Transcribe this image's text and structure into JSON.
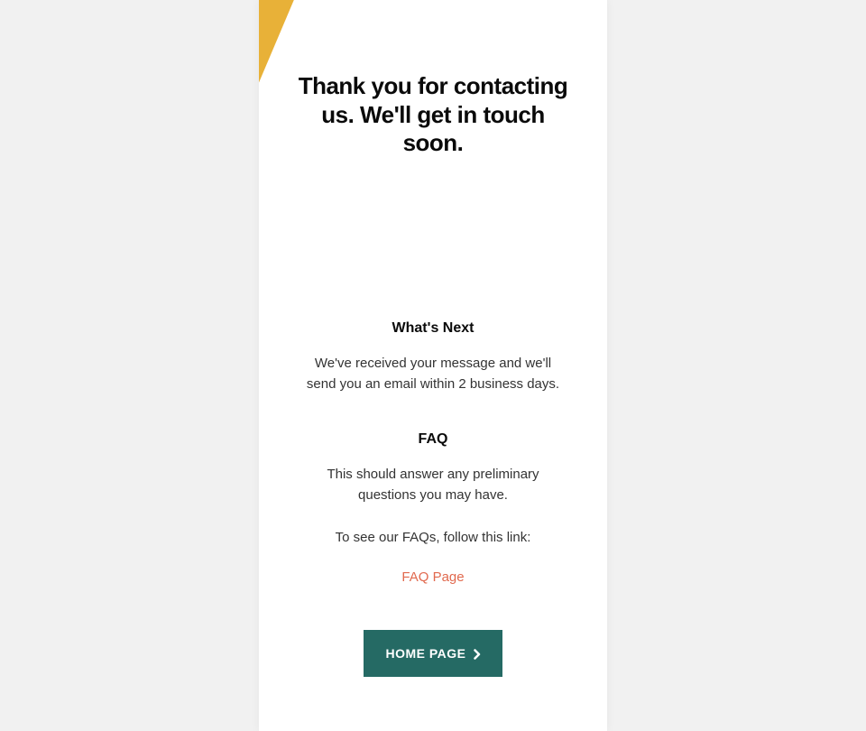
{
  "header": {
    "title": "Thank you for contacting us. We'll get in touch soon."
  },
  "sections": {
    "whats_next": {
      "title": "What's Next",
      "body": "We've received your message and we'll send you an email within 2 business days."
    },
    "faq": {
      "title": "FAQ",
      "body": "This should answer any preliminary questions you may have.",
      "prompt": "To see our FAQs, follow this link:",
      "link_label": "FAQ Page"
    }
  },
  "cta": {
    "label": "HOME PAGE"
  },
  "colors": {
    "accent_stripe": "#e8b138",
    "link": "#e1694e",
    "button_bg": "#256a64"
  }
}
